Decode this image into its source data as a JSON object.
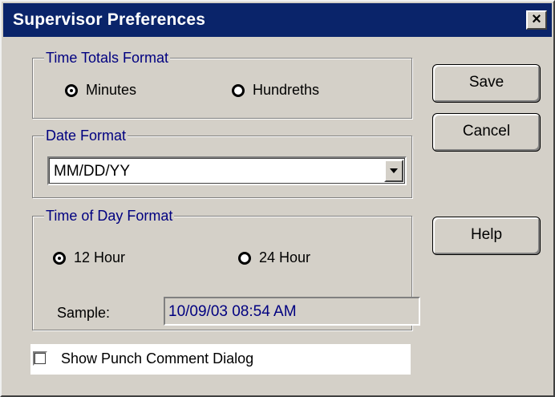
{
  "window": {
    "title": "Supervisor Preferences",
    "close_glyph": "×"
  },
  "time_totals": {
    "legend": "Time Totals Format",
    "options": [
      {
        "label": "Minutes",
        "checked": true
      },
      {
        "label": "Hundreths",
        "checked": false
      }
    ]
  },
  "date_format": {
    "legend": "Date Format",
    "selected": "MM/DD/YY"
  },
  "time_of_day": {
    "legend": "Time of Day Format",
    "options": [
      {
        "label": "12 Hour",
        "checked": true
      },
      {
        "label": "24 Hour",
        "checked": false
      }
    ],
    "sample_label": "Sample:",
    "sample_value": "10/09/03 08:54 AM"
  },
  "buttons": {
    "save": "Save",
    "cancel": "Cancel",
    "help": "Help"
  },
  "show_punch_comment": {
    "label": "Show Punch Comment Dialog",
    "checked": false
  },
  "colors": {
    "titlebar": "#0a246a",
    "dialog_face": "#d4d0c8",
    "legend_text": "#000080",
    "sample_text": "#000080"
  }
}
